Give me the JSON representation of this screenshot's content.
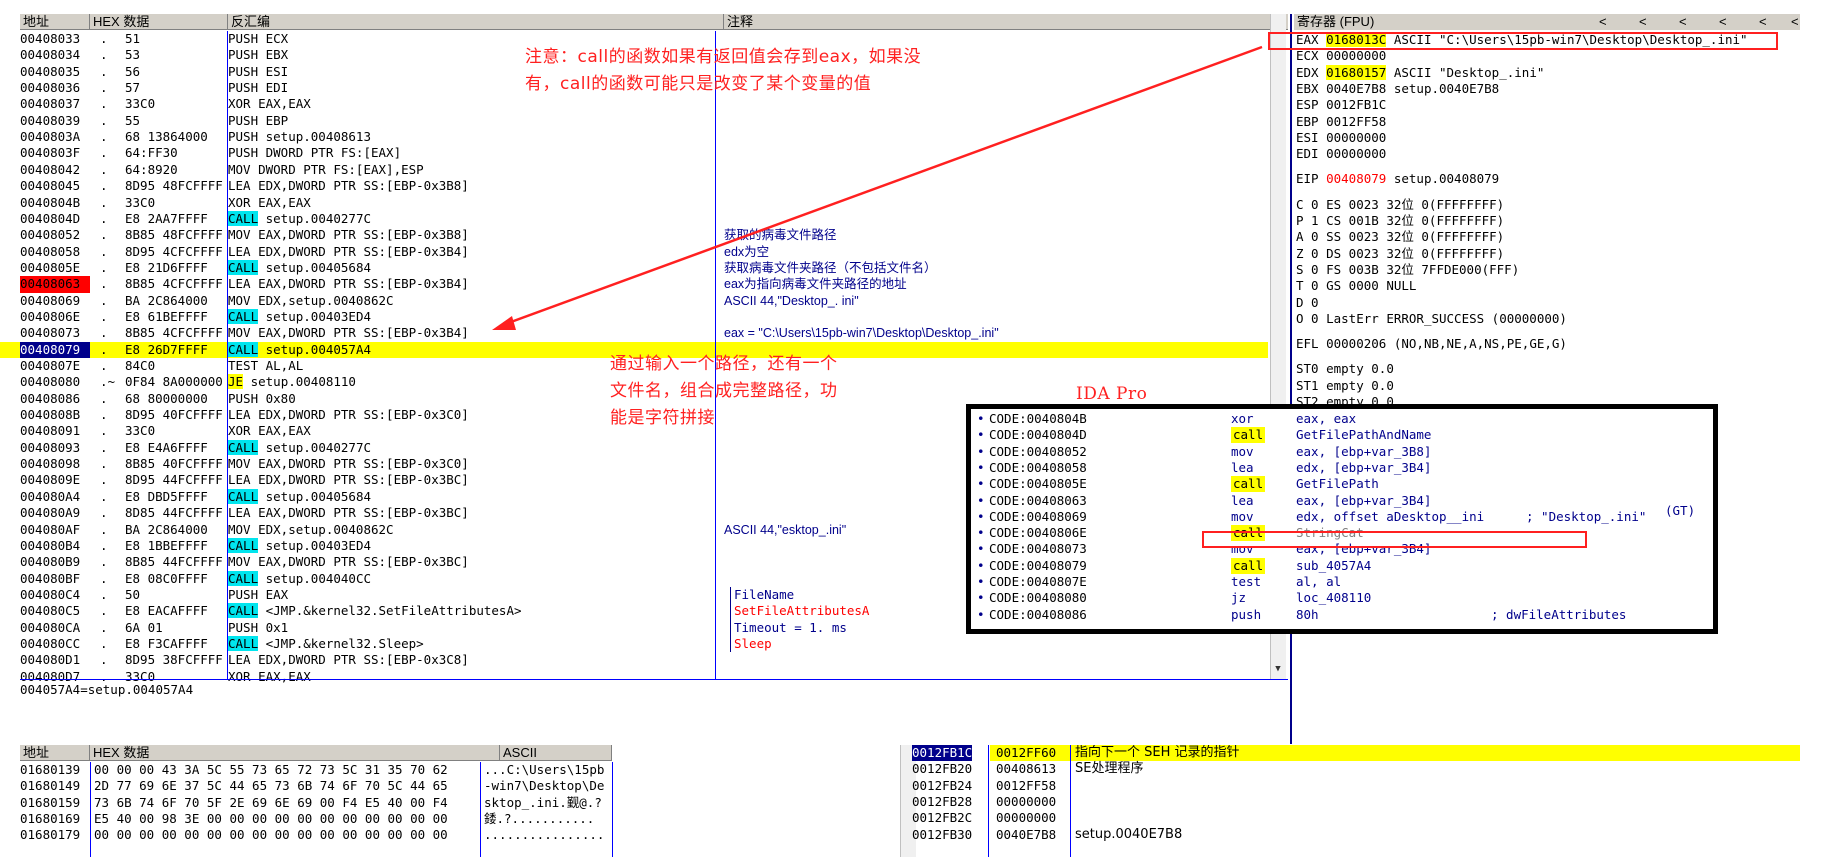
{
  "cpu": {
    "headers": {
      "addr": "地址",
      "hex": "HEX 数据",
      "asm": "反汇编",
      "comment": "注释"
    },
    "status_line": "004057A4=setup.004057A4",
    "rows": [
      {
        "addr": "00408033",
        "mark": ".",
        "hex": "51",
        "asm": "PUSH ECX",
        "cmt": ""
      },
      {
        "addr": "00408034",
        "mark": ".",
        "hex": "53",
        "asm": "PUSH EBX",
        "cmt": ""
      },
      {
        "addr": "00408035",
        "mark": ".",
        "hex": "56",
        "asm": "PUSH ESI",
        "cmt": ""
      },
      {
        "addr": "00408036",
        "mark": ".",
        "hex": "57",
        "asm": "PUSH EDI",
        "cmt": ""
      },
      {
        "addr": "00408037",
        "mark": ".",
        "hex": "33C0",
        "asm": "XOR EAX,EAX",
        "cmt": ""
      },
      {
        "addr": "00408039",
        "mark": ".",
        "hex": "55",
        "asm": "PUSH EBP",
        "cmt": ""
      },
      {
        "addr": "0040803A",
        "mark": ".",
        "hex": "68 13864000",
        "asm": "PUSH setup.00408613",
        "cmt": ""
      },
      {
        "addr": "0040803F",
        "mark": ".",
        "hex": "64:FF30",
        "asm": "PUSH DWORD PTR FS:[EAX]",
        "cmt": ""
      },
      {
        "addr": "00408042",
        "mark": ".",
        "hex": "64:8920",
        "asm": "MOV DWORD PTR FS:[EAX],ESP",
        "cmt": ""
      },
      {
        "addr": "00408045",
        "mark": ".",
        "hex": "8D95 48FCFFFF",
        "asm": "LEA EDX,DWORD PTR SS:[EBP-0x3B8]",
        "cmt": ""
      },
      {
        "addr": "0040804B",
        "mark": ".",
        "hex": "33C0",
        "asm": "XOR EAX,EAX",
        "cmt": ""
      },
      {
        "addr": "0040804D",
        "mark": ".",
        "hex": "E8 2AA7FFFF",
        "op": "CALL",
        "asm": "setup.0040277C",
        "cmt": ""
      },
      {
        "addr": "00408052",
        "mark": ".",
        "hex": "8B85 48FCFFFF",
        "asm": "MOV EAX,DWORD PTR SS:[EBP-0x3B8]",
        "cmt": "获取的病毒文件路径"
      },
      {
        "addr": "00408058",
        "mark": ".",
        "hex": "8D95 4CFCFFFF",
        "asm": "LEA EDX,DWORD PTR SS:[EBP-0x3B4]",
        "cmt": "edx为空"
      },
      {
        "addr": "0040805E",
        "mark": ".",
        "hex": "E8 21D6FFFF",
        "op": "CALL",
        "asm": "setup.00405684",
        "cmt": "获取病毒文件夹路径（不包括文件名）"
      },
      {
        "addr": "00408063",
        "mark": ".",
        "hex": "8B85 4CFCFFFF",
        "asm": "LEA EAX,DWORD PTR SS:[EBP-0x3B4]",
        "cmt": "eax为指向病毒文件夹路径的地址",
        "bp": true
      },
      {
        "addr": "00408069",
        "mark": ".",
        "hex": "BA 2C864000",
        "asm": "MOV EDX,setup.0040862C",
        "cmt": "ASCII 44,\"Desktop_. ini\""
      },
      {
        "addr": "0040806E",
        "mark": ".",
        "hex": "E8 61BEFFFF",
        "op": "CALL",
        "asm": "setup.00403ED4",
        "cmt": ""
      },
      {
        "addr": "00408073",
        "mark": ".",
        "hex": "8B85 4CFCFFFF",
        "asm": "MOV EAX,DWORD PTR SS:[EBP-0x3B4]",
        "cmt": "eax =  \"C:\\Users\\15pb-win7\\Desktop\\Desktop_.ini\""
      },
      {
        "addr": "00408079",
        "mark": ".",
        "hex": "E8 26D7FFFF",
        "op": "CALL",
        "asm": "setup.004057A4",
        "cmt": "",
        "cur": true
      },
      {
        "addr": "0040807E",
        "mark": ".",
        "hex": "84C0",
        "asm": "TEST AL,AL",
        "cmt": ""
      },
      {
        "addr": "00408080",
        "mark": ".~",
        "hex": "0F84 8A000000",
        "op": "JE",
        "asm": "setup.00408110",
        "cmt": ""
      },
      {
        "addr": "00408086",
        "mark": ".",
        "hex": "68 80000000",
        "asm": "PUSH 0x80",
        "cmt": ""
      },
      {
        "addr": "0040808B",
        "mark": ".",
        "hex": "8D95 40FCFFFF",
        "asm": "LEA EDX,DWORD PTR SS:[EBP-0x3C0]",
        "cmt": ""
      },
      {
        "addr": "00408091",
        "mark": ".",
        "hex": "33C0",
        "asm": "XOR EAX,EAX",
        "cmt": ""
      },
      {
        "addr": "00408093",
        "mark": ".",
        "hex": "E8 E4A6FFFF",
        "op": "CALL",
        "asm": "setup.0040277C",
        "cmt": ""
      },
      {
        "addr": "00408098",
        "mark": ".",
        "hex": "8B85 40FCFFFF",
        "asm": "MOV EAX,DWORD PTR SS:[EBP-0x3C0]",
        "cmt": ""
      },
      {
        "addr": "0040809E",
        "mark": ".",
        "hex": "8D95 44FCFFFF",
        "asm": "LEA EDX,DWORD PTR SS:[EBP-0x3BC]",
        "cmt": ""
      },
      {
        "addr": "004080A4",
        "mark": ".",
        "hex": "E8 DBD5FFFF",
        "op": "CALL",
        "asm": "setup.00405684",
        "cmt": ""
      },
      {
        "addr": "004080A9",
        "mark": ".",
        "hex": "8D85 44FCFFFF",
        "asm": "LEA EAX,DWORD PTR SS:[EBP-0x3BC]",
        "cmt": ""
      },
      {
        "addr": "004080AF",
        "mark": ".",
        "hex": "BA 2C864000",
        "asm": "MOV EDX,setup.0040862C",
        "cmt": "ASCII 44,\"esktop_.ini\""
      },
      {
        "addr": "004080B4",
        "mark": ".",
        "hex": "E8 1BBEFFFF",
        "op": "CALL",
        "asm": "setup.00403ED4",
        "cmt": ""
      },
      {
        "addr": "004080B9",
        "mark": ".",
        "hex": "8B85 44FCFFFF",
        "asm": "MOV EAX,DWORD PTR SS:[EBP-0x3BC]",
        "cmt": ""
      },
      {
        "addr": "004080BF",
        "mark": ".",
        "hex": "E8 08C0FFFF",
        "op": "CALL",
        "asm": "setup.004040CC",
        "cmt": ""
      },
      {
        "addr": "004080C4",
        "mark": ".",
        "hex": "50",
        "asm": "PUSH EAX",
        "cmt": "FileName",
        "cmtc": "#00008b",
        "br": "top"
      },
      {
        "addr": "004080C5",
        "mark": ".",
        "hex": "E8 EACAFFFF",
        "op": "CALL",
        "asm": "<JMP.&kernel32.SetFileAttributesA>",
        "cmt": "SetFileAttributesA",
        "cmtc": "#ff0000",
        "br": "bot"
      },
      {
        "addr": "004080CA",
        "mark": ".",
        "hex": "6A 01",
        "asm": "PUSH 0x1",
        "cmt": "Timeout = 1. ms",
        "cmtc": "#00008b",
        "br": "top"
      },
      {
        "addr": "004080CC",
        "mark": ".",
        "hex": "E8 F3CAFFFF",
        "op": "CALL",
        "asm": "<JMP.&kernel32.Sleep>",
        "cmt": "Sleep",
        "cmtc": "#ff0000",
        "br": "bot"
      },
      {
        "addr": "004080D1",
        "mark": ".",
        "hex": "8D95 38FCFFFF",
        "asm": "LEA EDX,DWORD PTR SS:[EBP-0x3C8]",
        "cmt": ""
      },
      {
        "addr": "004080D7",
        "mark": ".",
        "hex": "33C0",
        "asm": "XOR EAX,EAX",
        "cmt": ""
      }
    ]
  },
  "registers": {
    "title": "寄存器 (FPU)",
    "arrows": [
      "<",
      "<",
      "<",
      "<",
      "<",
      "<"
    ],
    "lines": [
      {
        "n": "EAX",
        "v": "0168013C",
        "t": "ASCII \"C:\\Users\\15pb-win7\\Desktop\\Desktop_.ini\"",
        "hl": true
      },
      {
        "n": "ECX",
        "v": "00000000",
        "t": ""
      },
      {
        "n": "EDX",
        "v": "01680157",
        "t": "ASCII \"Desktop_.ini\"",
        "hl": true
      },
      {
        "n": "EBX",
        "v": "0040E7B8",
        "t": "setup.0040E7B8"
      },
      {
        "n": "ESP",
        "v": "0012FB1C",
        "t": ""
      },
      {
        "n": "EBP",
        "v": "0012FF58",
        "t": ""
      },
      {
        "n": "ESI",
        "v": "00000000",
        "t": ""
      },
      {
        "n": "EDI",
        "v": "00000000",
        "t": ""
      },
      {
        "n": "",
        "v": "",
        "t": ""
      },
      {
        "n": "EIP",
        "v": "00408079",
        "t": "setup.00408079",
        "red": true
      },
      {
        "n": "",
        "v": "",
        "t": ""
      },
      {
        "n": "C 0",
        "v": "ES 0023",
        "t": "32位 0(FFFFFFFF)"
      },
      {
        "n": "P 1",
        "v": "CS 001B",
        "t": "32位 0(FFFFFFFF)"
      },
      {
        "n": "A 0",
        "v": "SS 0023",
        "t": "32位 0(FFFFFFFF)"
      },
      {
        "n": "Z 0",
        "v": "DS 0023",
        "t": "32位 0(FFFFFFFF)"
      },
      {
        "n": "S 0",
        "v": "FS 003B",
        "t": "32位 7FFDE000(FFF)"
      },
      {
        "n": "T 0",
        "v": "GS 0000",
        "t": "NULL"
      },
      {
        "n": "D 0",
        "v": "",
        "t": ""
      },
      {
        "n": "O 0",
        "v": "LastErr",
        "t": "ERROR_SUCCESS (00000000)"
      },
      {
        "n": "",
        "v": "",
        "t": ""
      },
      {
        "n": "EFL",
        "v": "00000206",
        "t": "(NO,NB,NE,A,NS,PE,GE,G)"
      },
      {
        "n": "",
        "v": "",
        "t": ""
      },
      {
        "n": "ST0",
        "v": "empty",
        "t": "0.0"
      },
      {
        "n": "ST1",
        "v": "empty",
        "t": "0.0"
      },
      {
        "n": "ST2",
        "v": "empty",
        "t": "0.0"
      }
    ]
  },
  "annotations": {
    "note1_l1": "注意：call的函数如果有返回值会存到eax，如果没",
    "note1_l2": "有，call的函数可能只是改变了某个变量的值",
    "note2_l1": "通过输入一个路径，还有一个",
    "note2_l2": "文件名，组合成完整路径，功",
    "note2_l3": "能是字符拼接",
    "ida_label": "IDA Pro"
  },
  "ida": {
    "gt": "(GT)",
    "rows": [
      {
        "a": "CODE:0040804B",
        "m": "xor",
        "o": "eax, eax"
      },
      {
        "a": "CODE:0040804D",
        "m": "call",
        "o": "GetFilePathAndName",
        "ref": true
      },
      {
        "a": "CODE:00408052",
        "m": "mov",
        "o": "eax, [ebp+var_3B8]"
      },
      {
        "a": "CODE:00408058",
        "m": "lea",
        "o": "edx, [ebp+var_3B4]"
      },
      {
        "a": "CODE:0040805E",
        "m": "call",
        "o": "GetFilePath",
        "ref": true
      },
      {
        "a": "CODE:00408063",
        "m": "lea",
        "o": "eax, [ebp+var_3B4]"
      },
      {
        "a": "CODE:00408069",
        "m": "mov",
        "o": "edx, offset aDesktop__ini",
        "c": "; \"Desktop_.ini\""
      },
      {
        "a": "CODE:0040806E",
        "m": "call",
        "o": "StringCat",
        "str": true
      },
      {
        "a": "CODE:00408073",
        "m": "mov",
        "o": "eax, [ebp+var_3B4]"
      },
      {
        "a": "CODE:00408079",
        "m": "call",
        "o": "sub_4057A4",
        "ref": true
      },
      {
        "a": "CODE:0040807E",
        "m": "test",
        "o": "al, al"
      },
      {
        "a": "CODE:00408080",
        "m": "jz",
        "o": "loc_408110"
      },
      {
        "a": "CODE:00408086",
        "m": "push",
        "o": "80h",
        "c": "; dwFileAttributes"
      }
    ]
  },
  "dump": {
    "headers": {
      "addr": "地址",
      "hex": "HEX 数据",
      "ascii": "ASCII"
    },
    "rows": [
      {
        "a": "01680139",
        "h": "00 00 00 43 3A 5C 55 73 65 72 73 5C 31 35 70 62",
        "s": "...C:\\Users\\15pb"
      },
      {
        "a": "01680149",
        "h": "2D 77 69 6E 37 5C 44 65 73 6B 74 6F 70 5C 44 65",
        "s": "-win7\\Desktop\\De"
      },
      {
        "a": "01680159",
        "h": "73 6B 74 6F 70 5F 2E 69 6E 69 00 F4 E5 40 00 F4",
        "s": "sktop_.ini.觐@.?"
      },
      {
        "a": "01680169",
        "h": "E5 40 00 98 3E 00 00 00 00 00 00 00 00 00 00 00",
        "s": "錗.?..........."
      },
      {
        "a": "01680179",
        "h": "00 00 00 00 00 00 00 00 00 00 00 00 00 00 00 00",
        "s": "................"
      }
    ]
  },
  "stack": {
    "rows": [
      {
        "a": "0012FB1C",
        "v": "0012FF60",
        "c": "指向下一个 SEH 记录的指针",
        "cur": true
      },
      {
        "a": "0012FB20",
        "v": "00408613",
        "c": "SE处理程序"
      },
      {
        "a": "0012FB24",
        "v": "0012FF58",
        "c": ""
      },
      {
        "a": "0012FB28",
        "v": "00000000",
        "c": ""
      },
      {
        "a": "0012FB2C",
        "v": "00000000",
        "c": ""
      },
      {
        "a": "0012FB30",
        "v": "0040E7B8",
        "c": "setup.0040E7B8"
      }
    ]
  }
}
